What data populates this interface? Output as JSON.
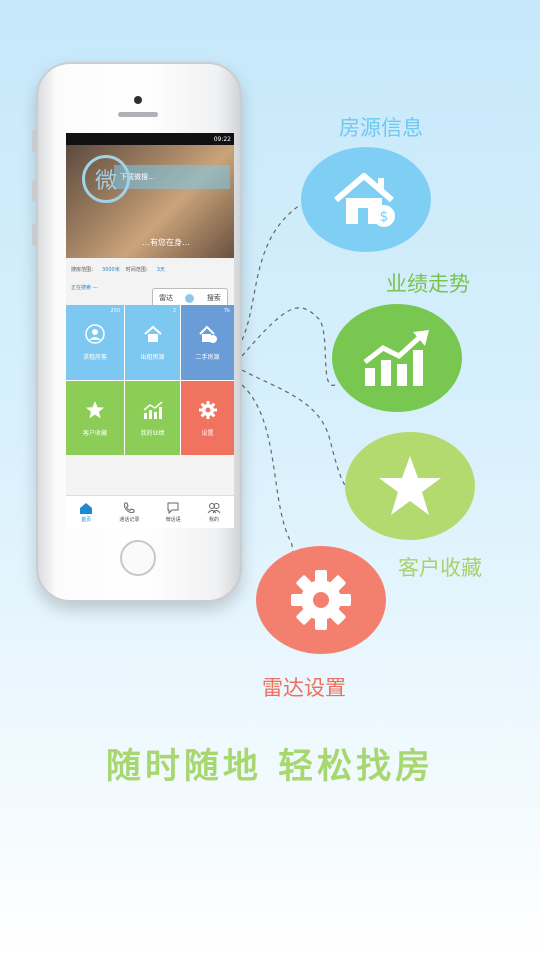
{
  "colors": {
    "blue": "#7fcff4",
    "green": "#77c751",
    "light_green": "#b2da6e",
    "orange": "#f3806f",
    "slogan": "#a7d86f"
  },
  "features": [
    {
      "label": "房源信息",
      "icon": "house-dollar-icon",
      "color": "#6fc8f0"
    },
    {
      "label": "业绩走势",
      "icon": "trend-chart-icon",
      "color": "#7bc34f"
    },
    {
      "label": "客户收藏",
      "icon": "star-icon",
      "color": "#a9d26a"
    },
    {
      "label": "雷达设置",
      "icon": "gear-icon",
      "color": "#ef6f5e"
    }
  ],
  "slogan": "随时随地   轻松找房",
  "phone": {
    "status_time": "09:22",
    "banner_logo": "微",
    "banner_strip": "下载微搜…",
    "banner_caption": "…有您在身…",
    "info": {
      "range_label": "搜房范围：",
      "range_value": "3000米",
      "time_label": "时间范围：",
      "time_value": "3天"
    },
    "history": "正在搜索 ---",
    "radar_label": "雷达",
    "search_label": "搜索",
    "tiles": [
      {
        "label": "求租房客",
        "count": "250",
        "icon": "user-icon",
        "color": "#7dc8f0"
      },
      {
        "label": "出租房源",
        "count": "2",
        "icon": "house-icon",
        "color": "#7dc8f0"
      },
      {
        "label": "二手房源",
        "count": "7k",
        "icon": "house-dollar-icon",
        "color": "#6a9dd8"
      },
      {
        "label": "客户收藏",
        "count": "",
        "icon": "star-icon",
        "color": "#8ccd58"
      },
      {
        "label": "我的业绩",
        "count": "",
        "icon": "trend-chart-icon",
        "color": "#8ccd58"
      },
      {
        "label": "设置",
        "count": "",
        "icon": "gear-icon",
        "color": "#f0735f"
      }
    ],
    "tabs": [
      {
        "label": "首页",
        "icon": "home-icon"
      },
      {
        "label": "通话记录",
        "icon": "phone-icon"
      },
      {
        "label": "微话语",
        "icon": "chat-icon"
      },
      {
        "label": "我的",
        "icon": "people-icon"
      }
    ]
  }
}
